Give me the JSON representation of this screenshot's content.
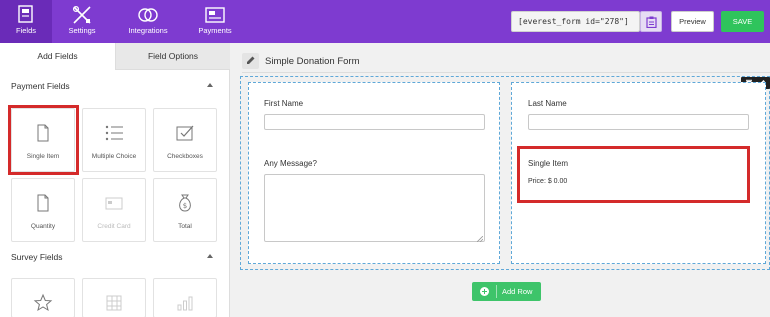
{
  "nav": {
    "items": [
      {
        "label": "Fields",
        "icon": "fields-icon",
        "active": true
      },
      {
        "label": "Settings",
        "icon": "settings-icon"
      },
      {
        "label": "Integrations",
        "icon": "integrations-icon"
      },
      {
        "label": "Payments",
        "icon": "payments-icon"
      }
    ],
    "accent": "#7e3bd0"
  },
  "toolbar": {
    "shortcode": "[everest_form id=\"278\"]",
    "copy_icon": "clipboard-icon",
    "preview_label": "Preview",
    "save_label": "SAVE"
  },
  "left_panel": {
    "tabs": [
      {
        "label": "Add Fields",
        "active": true
      },
      {
        "label": "Field Options"
      }
    ],
    "payment_section": {
      "title": "Payment Fields",
      "fields": [
        {
          "label": "Single Item",
          "icon": "file-icon",
          "highlighted": true
        },
        {
          "label": "Multiple Choice",
          "icon": "list-icon"
        },
        {
          "label": "Checkboxes",
          "icon": "checkbox-icon"
        },
        {
          "label": "Quantity",
          "icon": "file-icon"
        },
        {
          "label": "Credit Card",
          "icon": "credit-card-icon",
          "disabled": true
        },
        {
          "label": "Total",
          "icon": "money-bag-icon"
        }
      ]
    },
    "survey_section": {
      "title": "Survey Fields",
      "fields": [
        {
          "label": "",
          "icon": "star-icon"
        },
        {
          "label": "",
          "icon": "grid-icon",
          "disabled": true
        },
        {
          "label": "",
          "icon": "bar-chart-icon",
          "disabled": true
        }
      ]
    }
  },
  "form": {
    "title": "Simple Donation Form",
    "left_column": {
      "first_name_label": "First Name",
      "message_label": "Any Message?"
    },
    "right_column": {
      "last_name_label": "Last Name",
      "single_item_label": "Single Item",
      "price_text": "Price: $ 0.00"
    },
    "add_row_label": "Add Row"
  },
  "colors": {
    "highlight": "#d42a2a",
    "save": "#2fc45c",
    "add_row": "#3ec46a",
    "dashed_border": "#5fa8d8"
  }
}
